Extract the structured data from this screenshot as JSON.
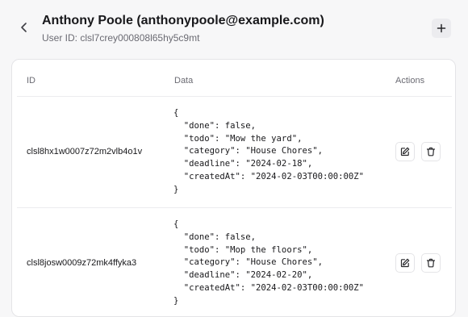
{
  "header": {
    "title": "Anthony Poole (anthonypoole@example.com)",
    "user_id_label": "User ID: ",
    "user_id": "clsl7crey000808l65hy5c9mt"
  },
  "table": {
    "columns": {
      "id": "ID",
      "data": "Data",
      "actions": "Actions"
    },
    "rows": [
      {
        "id": "clsl8hx1w0007z72m2vlb4o1v",
        "data": "{\n  \"done\": false,\n  \"todo\": \"Mow the yard\",\n  \"category\": \"House Chores\",\n  \"deadline\": \"2024-02-18\",\n  \"createdAt\": \"2024-02-03T00:00:00Z\"\n}"
      },
      {
        "id": "clsl8josw0009z72mk4ffyka3",
        "data": "{\n  \"done\": false,\n  \"todo\": \"Mop the floors\",\n  \"category\": \"House Chores\",\n  \"deadline\": \"2024-02-20\",\n  \"createdAt\": \"2024-02-03T00:00:00Z\"\n}"
      }
    ]
  },
  "icons": {
    "back": "chevron-left-icon",
    "add": "plus-icon",
    "edit": "edit-icon",
    "delete": "trash-icon"
  }
}
